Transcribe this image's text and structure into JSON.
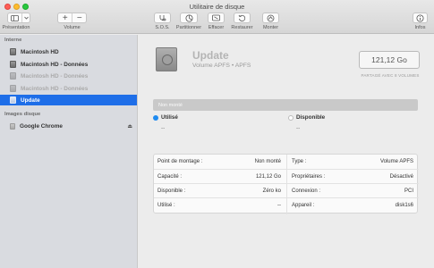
{
  "window": {
    "title": "Utilitaire de disque"
  },
  "toolbar": {
    "presentation": "Présentation",
    "volume": "Volume",
    "sos": "S.O.S.",
    "partition": "Partitionner",
    "erase": "Effacer",
    "restore": "Restaurer",
    "mount": "Monter",
    "info": "Infos"
  },
  "sidebar": {
    "internal_header": "Interne",
    "internal_items": [
      {
        "label": "Macintosh HD",
        "state": "normal"
      },
      {
        "label": "Macintosh HD - Données",
        "state": "normal"
      },
      {
        "label": "Macintosh HD - Données",
        "state": "dim"
      },
      {
        "label": "Macintosh HD - Données",
        "state": "dim"
      },
      {
        "label": "Update",
        "state": "selected"
      }
    ],
    "images_header": "Images disque",
    "image_items": [
      {
        "label": "Google Chrome",
        "eject": "⏏"
      }
    ]
  },
  "volume": {
    "name": "Update",
    "subtitle": "Volume APFS • APFS",
    "size": "121,12 Go",
    "size_caption": "PARTAGÉ AVEC 8 VOLUMES",
    "status_bar": "Non monté",
    "used_label": "Utilisé",
    "used_value": "--",
    "free_label": "Disponible",
    "free_value": "--"
  },
  "info": {
    "left": [
      {
        "label": "Point de montage :",
        "value": "Non monté"
      },
      {
        "label": "Capacité :",
        "value": "121,12 Go"
      },
      {
        "label": "Disponible :",
        "value": "Zéro ko"
      },
      {
        "label": "Utilisé :",
        "value": "--"
      }
    ],
    "right": [
      {
        "label": "Type :",
        "value": "Volume APFS"
      },
      {
        "label": "Propriétaires :",
        "value": "Désactivé"
      },
      {
        "label": "Connexion :",
        "value": "PCI"
      },
      {
        "label": "Appareil :",
        "value": "disk1s6"
      }
    ]
  },
  "colors": {
    "selection": "#1e6ee8",
    "used_dot": "#1f8bf0"
  }
}
